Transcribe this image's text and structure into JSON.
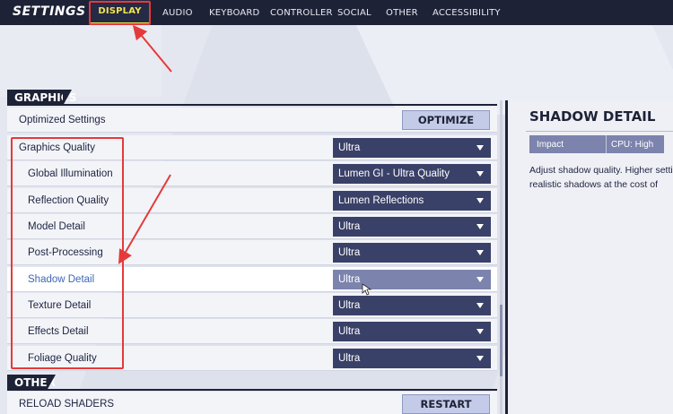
{
  "header": {
    "title": "SETTINGS",
    "tabs": [
      {
        "label": "DISPLAY",
        "active": true
      },
      {
        "label": "AUDIO",
        "active": false
      },
      {
        "label": "KEYBOARD",
        "active": false
      },
      {
        "label": "CONTROLLER",
        "active": false
      },
      {
        "label": "SOCIAL",
        "active": false
      },
      {
        "label": "OTHER",
        "active": false
      },
      {
        "label": "ACCESSIBILITY",
        "active": false
      }
    ]
  },
  "graphics": {
    "section_title": "GRAPHICS",
    "optimized": {
      "label": "Optimized Settings",
      "button": "OPTIMIZE"
    },
    "rows": [
      {
        "label": "Graphics Quality",
        "value": "Ultra"
      },
      {
        "label": "Global Illumination",
        "value": "Lumen GI - Ultra Quality"
      },
      {
        "label": "Reflection Quality",
        "value": "Lumen Reflections"
      },
      {
        "label": "Model Detail",
        "value": "Ultra"
      },
      {
        "label": "Post-Processing",
        "value": "Ultra"
      },
      {
        "label": "Shadow Detail",
        "value": "Ultra"
      },
      {
        "label": "Texture Detail",
        "value": "Ultra"
      },
      {
        "label": "Effects Detail",
        "value": "Ultra"
      },
      {
        "label": "Foliage Quality",
        "value": "Ultra"
      }
    ]
  },
  "other": {
    "section_title": "OTHER",
    "reload": {
      "label": "RELOAD SHADERS",
      "button": "RESTART"
    }
  },
  "detail_panel": {
    "title": "SHADOW DETAIL",
    "impact_label": "Impact",
    "impact_value": "CPU: High",
    "description_line1": "Adjust shadow quality. Higher settings",
    "description_line2": "realistic shadows at the cost of"
  },
  "colors": {
    "accent_yellow": "#f3e24f",
    "annotation_red": "#e53a3a",
    "dark_navy": "#1e2236",
    "dropdown": "#3a4168"
  }
}
